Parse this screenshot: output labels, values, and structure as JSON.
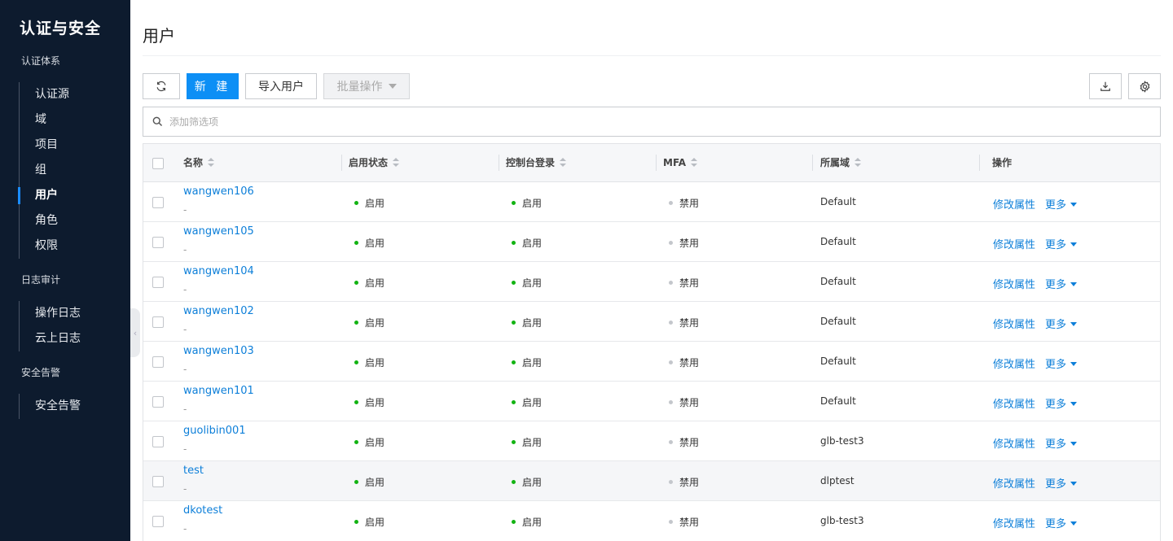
{
  "sidebar": {
    "title": "认证与安全",
    "groups": [
      {
        "label": "认证体系",
        "items": [
          "认证源",
          "域",
          "项目",
          "组",
          "用户",
          "角色",
          "权限"
        ]
      },
      {
        "label": "日志审计",
        "items": [
          "操作日志",
          "云上日志"
        ]
      },
      {
        "label": "安全告警",
        "items": [
          "安全告警"
        ]
      }
    ],
    "active_item": "用户"
  },
  "page": {
    "title": "用户"
  },
  "toolbar": {
    "refresh_icon": "refresh-icon",
    "new_label": "新 建",
    "import_label": "导入用户",
    "batch_label": "批量操作",
    "download_icon": "download-icon",
    "settings_icon": "gear-icon"
  },
  "search": {
    "placeholder": "添加筛选项"
  },
  "table": {
    "columns": [
      "名称",
      "启用状态",
      "控制台登录",
      "MFA",
      "所属域",
      "操作"
    ],
    "rows": [
      {
        "name": "wangwen106",
        "desc": "-",
        "enabled": "启用",
        "console": "启用",
        "mfa": "禁用",
        "domain": "Default",
        "edit": "修改属性",
        "more": "更多"
      },
      {
        "name": "wangwen105",
        "desc": "-",
        "enabled": "启用",
        "console": "启用",
        "mfa": "禁用",
        "domain": "Default",
        "edit": "修改属性",
        "more": "更多"
      },
      {
        "name": "wangwen104",
        "desc": "-",
        "enabled": "启用",
        "console": "启用",
        "mfa": "禁用",
        "domain": "Default",
        "edit": "修改属性",
        "more": "更多"
      },
      {
        "name": "wangwen102",
        "desc": "-",
        "enabled": "启用",
        "console": "启用",
        "mfa": "禁用",
        "domain": "Default",
        "edit": "修改属性",
        "more": "更多"
      },
      {
        "name": "wangwen103",
        "desc": "-",
        "enabled": "启用",
        "console": "启用",
        "mfa": "禁用",
        "domain": "Default",
        "edit": "修改属性",
        "more": "更多"
      },
      {
        "name": "wangwen101",
        "desc": "-",
        "enabled": "启用",
        "console": "启用",
        "mfa": "禁用",
        "domain": "Default",
        "edit": "修改属性",
        "more": "更多"
      },
      {
        "name": "guolibin001",
        "desc": "-",
        "enabled": "启用",
        "console": "启用",
        "mfa": "禁用",
        "domain": "glb-test3",
        "edit": "修改属性",
        "more": "更多"
      },
      {
        "name": "test",
        "desc": "-",
        "enabled": "启用",
        "console": "启用",
        "mfa": "禁用",
        "domain": "dlptest",
        "edit": "修改属性",
        "more": "更多"
      },
      {
        "name": "dkotest",
        "desc": "-",
        "enabled": "启用",
        "console": "启用",
        "mfa": "禁用",
        "domain": "glb-test3",
        "edit": "修改属性",
        "more": "更多"
      }
    ]
  },
  "colors": {
    "sidebar_bg": "#0d1b2e",
    "primary": "#0d8ff5",
    "link": "#0d7fd9",
    "enabled_dot": "#12b312",
    "disabled_dot": "#c4c7cc"
  }
}
